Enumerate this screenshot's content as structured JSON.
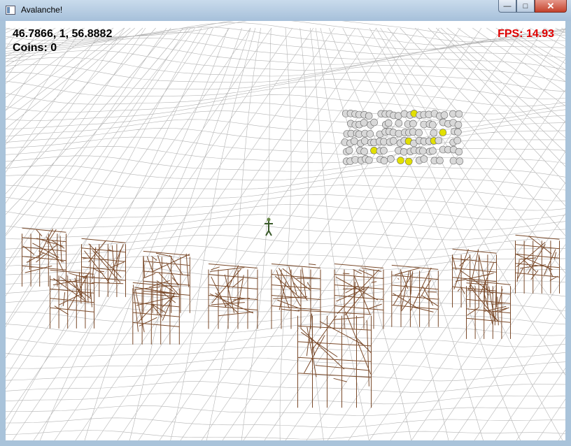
{
  "window": {
    "title": "Avalanche!",
    "minimize_glyph": "—",
    "maximize_glyph": "□",
    "close_glyph": "✕"
  },
  "hud": {
    "position": "46.7866, 1, 56.8882",
    "coins": "Coins: 0",
    "fps": "FPS: 14.93"
  },
  "colors": {
    "hud_text": "#000000",
    "fps_text": "#e00000",
    "terrain_wire": "#b4b4b4",
    "building_wire": "#7a4a2a",
    "coin": "#e2e000",
    "boulder": "#d8d8d8"
  },
  "icons": [
    "app-window-icon",
    "minimize-icon",
    "maximize-icon",
    "close-icon"
  ]
}
